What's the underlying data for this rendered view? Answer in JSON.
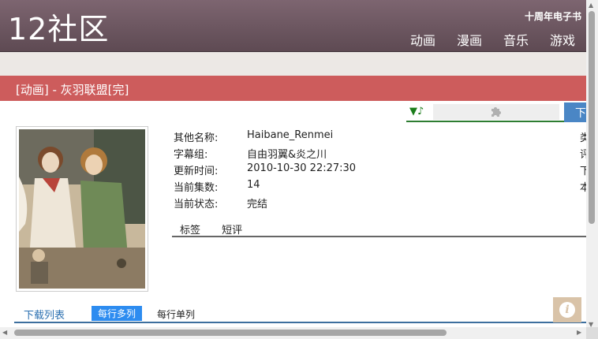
{
  "header": {
    "logo": "12社区",
    "ebook_link": "十周年电子书",
    "nav": [
      "动画",
      "漫画",
      "音乐",
      "游戏"
    ]
  },
  "title_bar": {
    "text": "[动画] - 灰羽联盟[完]"
  },
  "player": {
    "music_icon": "▼♪",
    "plugin_icon": "puzzle-icon"
  },
  "download_button": {
    "label": "下"
  },
  "info": {
    "rows": [
      {
        "label": "其他名称:",
        "value": "Haibane_Renmei"
      },
      {
        "label": "字幕组:",
        "value": "自由羽翼&炎之川"
      },
      {
        "label": "更新时间:",
        "value": "2010-10-30 22:27:30"
      },
      {
        "label": "当前集数:",
        "value": "14"
      },
      {
        "label": "当前状态:",
        "value": "完结"
      }
    ],
    "right_column_cut": [
      "类",
      "评",
      "下",
      "本"
    ]
  },
  "tabs": [
    "标签",
    "短评"
  ],
  "download_list": {
    "title": "下载列表",
    "multi_column": "每行多列",
    "single_column": "每行单列"
  },
  "colors": {
    "header": "#6b5660",
    "title_bar": "#cd5c5c",
    "accent_blue": "#2d8cf0",
    "player_green": "#2e7d32"
  },
  "scrollbars": {
    "vertical": "scrollbar-vertical",
    "horizontal": "scrollbar-horizontal"
  }
}
